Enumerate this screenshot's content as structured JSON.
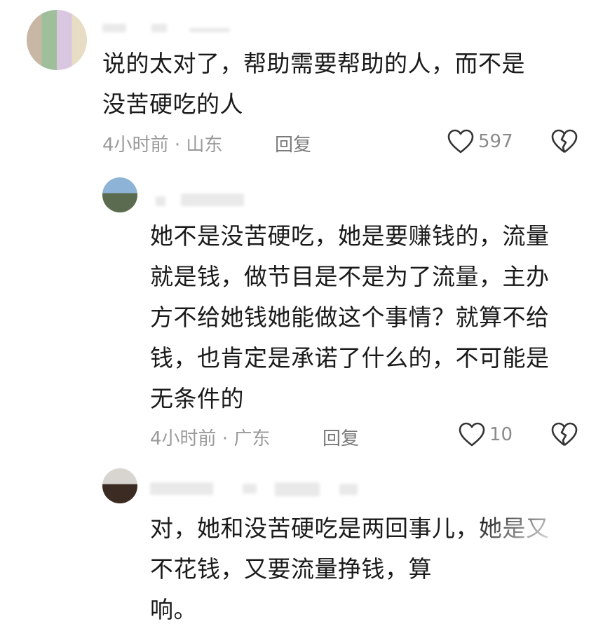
{
  "comments": [
    {
      "text": "说的太对了，帮助需要帮助的人，而不是\n没苦硬吃的人",
      "time": "4小时前",
      "separator": "·",
      "location": "山东",
      "reply_label": "回复",
      "likes": "597"
    },
    {
      "text": "她不是没苦硬吃，她是要赚钱的，流量\n就是钱，做节目是不是为了流量，主办\n方不给她钱她能做这个事情？就算不给\n钱，也肯定是承诺了什么的，不可能是\n无条件的",
      "time": "4小时前",
      "separator": "·",
      "location": "广东",
      "reply_label": "回复",
      "likes": "10"
    },
    {
      "text": "对，她和没苦硬吃是两回事儿，她是又\n不花钱，又要流量挣钱，算\n响。"
    }
  ],
  "icons": {
    "like": "heart-outline-icon",
    "dislike": "broken-heart-icon"
  },
  "colors": {
    "text": "#1a1a1a",
    "meta": "#9a9a9a",
    "icon": "#333333"
  }
}
